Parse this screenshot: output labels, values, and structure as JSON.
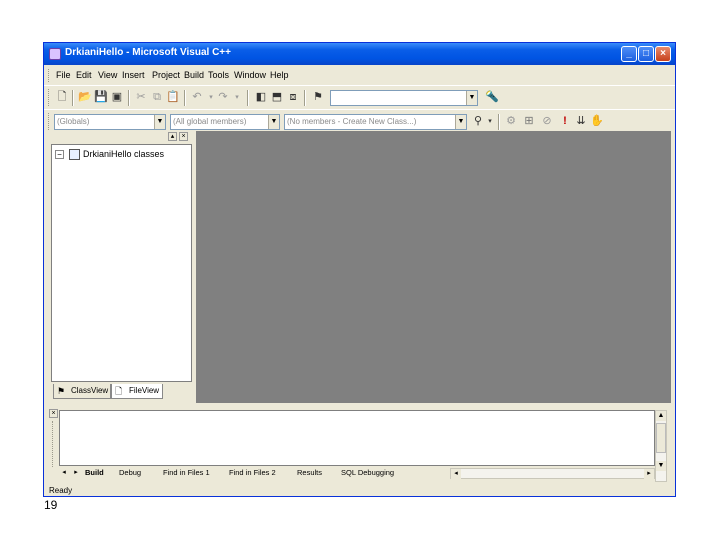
{
  "window": {
    "title": "DrkianiHello - Microsoft Visual C++",
    "title_bar_color": "#0054e3",
    "controls": {
      "minimize": "_",
      "maximize": "□",
      "close": "×"
    }
  },
  "menu": [
    "File",
    "Edit",
    "View",
    "Insert",
    "Project",
    "Build",
    "Tools",
    "Window",
    "Help"
  ],
  "toolbar1": {
    "icons": [
      "new-text-file-icon",
      "open-folder-icon",
      "save-icon",
      "save-all-icon",
      "cut-icon",
      "copy-icon",
      "paste-icon",
      "undo-icon",
      "redo-icon",
      "workspace-icon",
      "output-icon",
      "window-list-icon",
      "find-in-files-icon",
      "find-icon"
    ],
    "find_combo_value": ""
  },
  "toolbar2": {
    "class_combo": "(Globals)",
    "members_combo": "(All global members)",
    "function_combo": "(No members - Create New Class...)",
    "build_icons": [
      "compile-icon",
      "build-icon",
      "stop-build-icon",
      "execute-icon",
      "go-icon",
      "breakpoint-icon"
    ]
  },
  "workspace": {
    "tree_root": "DrkianiHello classes",
    "expander": "−",
    "tabs": [
      "ClassView",
      "FileView"
    ]
  },
  "output": {
    "tabs": [
      "Build",
      "Debug",
      "Find in Files 1",
      "Find in Files 2",
      "Results",
      "SQL Debugging"
    ]
  },
  "status": {
    "text": "Ready"
  },
  "slide_number": "19",
  "colors": {
    "chrome": "#ece9d8",
    "mdi_background": "#808080"
  }
}
